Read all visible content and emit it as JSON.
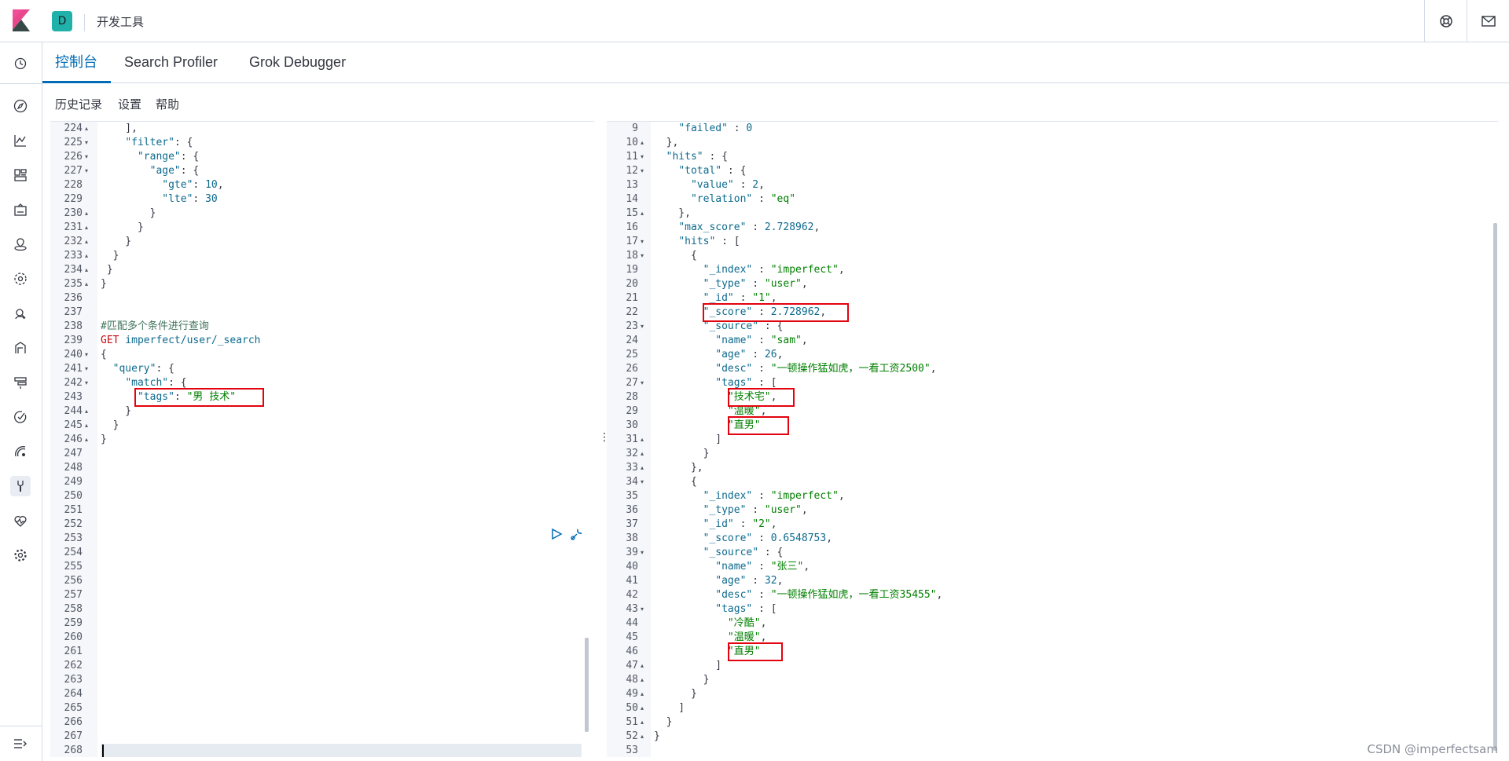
{
  "header": {
    "space_initial": "D",
    "breadcrumb": "开发工具",
    "right_icons": [
      "help-icon",
      "mail-icon"
    ]
  },
  "nav": {
    "icons": [
      "clock-icon",
      "compass-icon",
      "visualize-icon",
      "dashboard-icon",
      "canvas-icon",
      "maps-icon",
      "ml-icon",
      "metrics-icon",
      "logs-icon",
      "apm-icon",
      "uptime-icon",
      "siem-icon",
      "devtools-icon",
      "monitoring-icon",
      "management-icon"
    ],
    "collapse_icon": "collapse-icon"
  },
  "tabs": [
    "控制台",
    "Search Profiler",
    "Grok Debugger"
  ],
  "subnav": [
    "历史记录",
    "设置",
    "帮助"
  ],
  "left_editor": {
    "lines": [
      {
        "n": "224",
        "f": "▴",
        "t": "    ],"
      },
      {
        "n": "225",
        "f": "▾",
        "t": "    \"filter\": {"
      },
      {
        "n": "226",
        "f": "▾",
        "t": "      \"range\": {"
      },
      {
        "n": "227",
        "f": "▾",
        "t": "        \"age\": {"
      },
      {
        "n": "228",
        "f": "",
        "t": "          \"gte\": 10,"
      },
      {
        "n": "229",
        "f": "",
        "t": "          \"lte\": 30"
      },
      {
        "n": "230",
        "f": "▴",
        "t": "        }"
      },
      {
        "n": "231",
        "f": "▴",
        "t": "      }"
      },
      {
        "n": "232",
        "f": "▴",
        "t": "    }"
      },
      {
        "n": "233",
        "f": "▴",
        "t": "  }"
      },
      {
        "n": "234",
        "f": "▴",
        "t": " }"
      },
      {
        "n": "235",
        "f": "▴",
        "t": "}"
      },
      {
        "n": "236",
        "f": "",
        "t": ""
      },
      {
        "n": "237",
        "f": "",
        "t": ""
      },
      {
        "n": "238",
        "f": "",
        "t": "#匹配多个条件进行查询"
      },
      {
        "n": "239",
        "f": "",
        "t": "GET imperfect/user/_search"
      },
      {
        "n": "240",
        "f": "▾",
        "t": "{"
      },
      {
        "n": "241",
        "f": "▾",
        "t": "  \"query\": {"
      },
      {
        "n": "242",
        "f": "▾",
        "t": "    \"match\": {"
      },
      {
        "n": "243",
        "f": "",
        "t": "      \"tags\": \"男 技术\""
      },
      {
        "n": "244",
        "f": "▴",
        "t": "    }"
      },
      {
        "n": "245",
        "f": "▴",
        "t": "  }"
      },
      {
        "n": "246",
        "f": "▴",
        "t": "}"
      },
      {
        "n": "247",
        "f": "",
        "t": ""
      },
      {
        "n": "248",
        "f": "",
        "t": ""
      },
      {
        "n": "249",
        "f": "",
        "t": ""
      },
      {
        "n": "250",
        "f": "",
        "t": ""
      },
      {
        "n": "251",
        "f": "",
        "t": ""
      },
      {
        "n": "252",
        "f": "",
        "t": ""
      },
      {
        "n": "253",
        "f": "",
        "t": ""
      },
      {
        "n": "254",
        "f": "",
        "t": ""
      },
      {
        "n": "255",
        "f": "",
        "t": ""
      },
      {
        "n": "256",
        "f": "",
        "t": ""
      },
      {
        "n": "257",
        "f": "",
        "t": ""
      },
      {
        "n": "258",
        "f": "",
        "t": ""
      },
      {
        "n": "259",
        "f": "",
        "t": ""
      },
      {
        "n": "260",
        "f": "",
        "t": ""
      },
      {
        "n": "261",
        "f": "",
        "t": ""
      },
      {
        "n": "262",
        "f": "",
        "t": ""
      },
      {
        "n": "263",
        "f": "",
        "t": ""
      },
      {
        "n": "264",
        "f": "",
        "t": ""
      },
      {
        "n": "265",
        "f": "",
        "t": ""
      },
      {
        "n": "266",
        "f": "",
        "t": ""
      },
      {
        "n": "267",
        "f": "",
        "t": ""
      },
      {
        "n": "268",
        "f": "",
        "t": ""
      }
    ],
    "action_icons": [
      "play-icon",
      "wrench-icon"
    ]
  },
  "right_editor": {
    "lines": [
      {
        "n": "9",
        "f": "",
        "t": "    \"failed\" : 0"
      },
      {
        "n": "10",
        "f": "▴",
        "t": "  },"
      },
      {
        "n": "11",
        "f": "▾",
        "t": "  \"hits\" : {"
      },
      {
        "n": "12",
        "f": "▾",
        "t": "    \"total\" : {"
      },
      {
        "n": "13",
        "f": "",
        "t": "      \"value\" : 2,"
      },
      {
        "n": "14",
        "f": "",
        "t": "      \"relation\" : \"eq\""
      },
      {
        "n": "15",
        "f": "▴",
        "t": "    },"
      },
      {
        "n": "16",
        "f": "",
        "t": "    \"max_score\" : 2.728962,"
      },
      {
        "n": "17",
        "f": "▾",
        "t": "    \"hits\" : ["
      },
      {
        "n": "18",
        "f": "▾",
        "t": "      {"
      },
      {
        "n": "19",
        "f": "",
        "t": "        \"_index\" : \"imperfect\","
      },
      {
        "n": "20",
        "f": "",
        "t": "        \"_type\" : \"user\","
      },
      {
        "n": "21",
        "f": "",
        "t": "        \"_id\" : \"1\","
      },
      {
        "n": "22",
        "f": "",
        "t": "        \"_score\" : 2.728962,"
      },
      {
        "n": "23",
        "f": "▾",
        "t": "        \"_source\" : {"
      },
      {
        "n": "24",
        "f": "",
        "t": "          \"name\" : \"sam\","
      },
      {
        "n": "25",
        "f": "",
        "t": "          \"age\" : 26,"
      },
      {
        "n": "26",
        "f": "",
        "t": "          \"desc\" : \"一顿操作猛如虎，一看工资2500\","
      },
      {
        "n": "27",
        "f": "▾",
        "t": "          \"tags\" : ["
      },
      {
        "n": "28",
        "f": "",
        "t": "            \"技术宅\","
      },
      {
        "n": "29",
        "f": "",
        "t": "            \"温暖\","
      },
      {
        "n": "30",
        "f": "",
        "t": "            \"直男\""
      },
      {
        "n": "31",
        "f": "▴",
        "t": "          ]"
      },
      {
        "n": "32",
        "f": "▴",
        "t": "        }"
      },
      {
        "n": "33",
        "f": "▴",
        "t": "      },"
      },
      {
        "n": "34",
        "f": "▾",
        "t": "      {"
      },
      {
        "n": "35",
        "f": "",
        "t": "        \"_index\" : \"imperfect\","
      },
      {
        "n": "36",
        "f": "",
        "t": "        \"_type\" : \"user\","
      },
      {
        "n": "37",
        "f": "",
        "t": "        \"_id\" : \"2\","
      },
      {
        "n": "38",
        "f": "",
        "t": "        \"_score\" : 0.6548753,"
      },
      {
        "n": "39",
        "f": "▾",
        "t": "        \"_source\" : {"
      },
      {
        "n": "40",
        "f": "",
        "t": "          \"name\" : \"张三\","
      },
      {
        "n": "41",
        "f": "",
        "t": "          \"age\" : 32,"
      },
      {
        "n": "42",
        "f": "",
        "t": "          \"desc\" : \"一顿操作猛如虎，一看工资35455\","
      },
      {
        "n": "43",
        "f": "▾",
        "t": "          \"tags\" : ["
      },
      {
        "n": "44",
        "f": "",
        "t": "            \"冷酷\","
      },
      {
        "n": "45",
        "f": "",
        "t": "            \"温暖\","
      },
      {
        "n": "46",
        "f": "",
        "t": "            \"直男\""
      },
      {
        "n": "47",
        "f": "▴",
        "t": "          ]"
      },
      {
        "n": "48",
        "f": "▴",
        "t": "        }"
      },
      {
        "n": "49",
        "f": "▴",
        "t": "      }"
      },
      {
        "n": "50",
        "f": "▴",
        "t": "    ]"
      },
      {
        "n": "51",
        "f": "▴",
        "t": "  }"
      },
      {
        "n": "52",
        "f": "▴",
        "t": "}"
      },
      {
        "n": "53",
        "f": "",
        "t": ""
      }
    ]
  },
  "watermark": "CSDN @imperfectsam",
  "colors": {
    "accent": "#006bb4",
    "highlight_box": "#e3030f",
    "json_key": "#0d6a8e",
    "json_string": "#007f00",
    "method": "#c80a14",
    "comment": "#41755c"
  }
}
